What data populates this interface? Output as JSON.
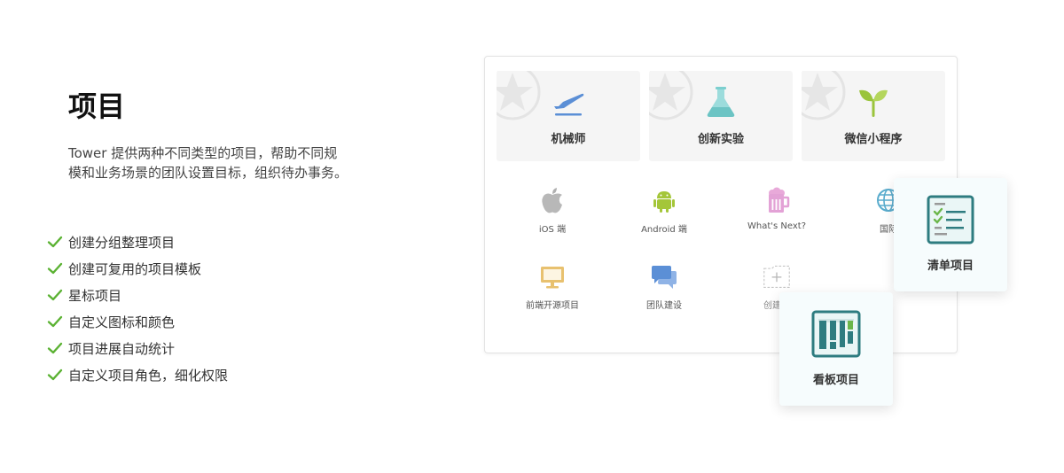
{
  "section": {
    "title": "项目",
    "description": "Tower 提供两种不同类型的项目，帮助不同规模和业务场景的团队设置目标，组织待办事务。",
    "features": [
      "创建分组整理项目",
      "创建可复用的项目模板",
      "星标项目",
      "自定义图标和颜色",
      "项目进展自动统计",
      "自定义项目角色，细化权限"
    ]
  },
  "colors": {
    "check": "#5bb233",
    "plane": "#5b8fd6",
    "flask": "#7ccfcf",
    "sprout": "#9ac43c",
    "apple": "#b0b0b0",
    "android": "#a4c639",
    "whatsnext": "#e3a2d6",
    "globe": "#5aaccd",
    "monitor": "#e8c16f",
    "chat": "#5b8fd6",
    "teal": "#2e7c80"
  },
  "templates": [
    {
      "label": "机械师",
      "icon": "plane-icon"
    },
    {
      "label": "创新实验",
      "icon": "flask-icon"
    },
    {
      "label": "微信小程序",
      "icon": "sprout-icon"
    }
  ],
  "projects": [
    {
      "label": "iOS 端",
      "icon": "apple-icon"
    },
    {
      "label": "Android 端",
      "icon": "android-icon"
    },
    {
      "label": "What's Next?",
      "icon": "beer-icon"
    },
    {
      "label": "国际",
      "icon": "globe-icon"
    },
    {
      "label": "前端开源项目",
      "icon": "monitor-icon"
    },
    {
      "label": "团队建设",
      "icon": "chat-icon"
    },
    {
      "label": "创建新",
      "icon": "add-folder-icon"
    }
  ],
  "float_cards": {
    "list": {
      "label": "清单项目",
      "icon": "checklist-icon"
    },
    "kanban": {
      "label": "看板项目",
      "icon": "kanban-icon"
    }
  }
}
